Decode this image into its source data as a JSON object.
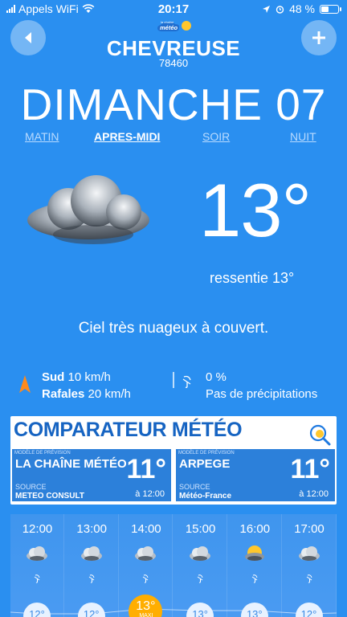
{
  "status": {
    "carrier": "Appels WiFi",
    "time": "20:17",
    "battery": "48 %",
    "battery_level": 0.48
  },
  "header": {
    "city": "CHEVREUSE",
    "postal_code": "78460",
    "logo_text": "la chaîne météo"
  },
  "day": {
    "title": "DIMANCHE 07",
    "periods": [
      "MATIN",
      "APRES-MIDI",
      "SOIR",
      "NUIT"
    ],
    "active_period": "APRES-MIDI"
  },
  "current": {
    "temperature": "13°",
    "feels_like": "ressentie 13°",
    "description": "Ciel très nuageux à couvert.",
    "wind_direction": "Sud",
    "wind_speed": "10 km/h",
    "gusts_label": "Rafales",
    "gusts_speed": "20 km/h",
    "precip_percent": "0 %",
    "precip_text": "Pas de précipitations"
  },
  "comparator": {
    "title": "COMPARATEUR MÉTÉO",
    "cards": [
      {
        "tag": "MODÈLE DE PRÉVISION",
        "name": "LA CHAÎNE MÉTÉO",
        "temperature": "11°",
        "source_label": "SOURCE",
        "source": "METEO CONSULT",
        "time": "à 12:00"
      },
      {
        "tag": "MODÈLE DE PRÉVISION",
        "name": "ARPEGE",
        "temperature": "11°",
        "source_label": "SOURCE",
        "source": "Météo-France",
        "time": "à 12:00"
      }
    ]
  },
  "hourly": [
    {
      "time": "12:00",
      "icon": "cloud-icon",
      "temp": "12°",
      "max": false
    },
    {
      "time": "13:00",
      "icon": "cloud-icon",
      "temp": "12°",
      "max": false
    },
    {
      "time": "14:00",
      "icon": "cloud-icon",
      "temp": "13°",
      "max": true,
      "max_label": "MAXI"
    },
    {
      "time": "15:00",
      "icon": "cloud-icon",
      "temp": "13°",
      "max": false
    },
    {
      "time": "16:00",
      "icon": "sun-cloud-icon",
      "temp": "13°",
      "max": false
    },
    {
      "time": "17:00",
      "icon": "cloud-icon",
      "temp": "12°",
      "max": false
    }
  ],
  "colors": {
    "background": "#2a8ff0",
    "comparator_title": "#1664c2",
    "card": "#2c80da",
    "max_badge": "#ffae00"
  }
}
